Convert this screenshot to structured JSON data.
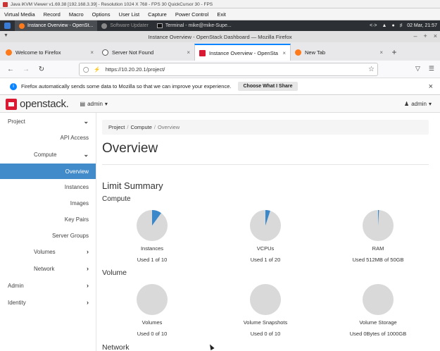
{
  "vnc": {
    "title": "Java iKVM Viewer v1.69.38 [192.168.3.39] - Resolution 1024 X 768 - FPS 30 QuickCursor 30 - FPS",
    "menu": [
      "Virtual Media",
      "Record",
      "Macro",
      "Options",
      "User List",
      "Capture",
      "Power Control",
      "Exit"
    ]
  },
  "taskbar": {
    "tasks": [
      {
        "label": "Instance Overview - OpenSt...",
        "active": true
      },
      {
        "label": "Software Updater",
        "active": false
      },
      {
        "label": "Terminal - mike@mike-Supe...",
        "active": false
      }
    ],
    "clock": "02 Mar, 21:57"
  },
  "browser": {
    "window_title": "Instance Overview - OpenStack Dashboard — Mozilla Firefox",
    "tabs": [
      {
        "label": "Welcome to Firefox",
        "icon": "firefox-icon",
        "active": false
      },
      {
        "label": "Server Not Found",
        "icon": "info-icon",
        "active": false
      },
      {
        "label": "Instance Overview - OpenSta",
        "icon": "openstack-icon",
        "active": true
      },
      {
        "label": "New Tab",
        "icon": "firefox-icon",
        "active": false
      }
    ],
    "url": "https://10.20.20.1/project/",
    "notification": "Firefox automatically sends some data to Mozilla so that we can improve your experience.",
    "notification_button": "Choose What I Share"
  },
  "header": {
    "logo_text": "openstack.",
    "project": "admin",
    "user": "admin"
  },
  "sidebar": [
    {
      "label": "Project",
      "level": 1,
      "chevron": "down"
    },
    {
      "label": "API Access",
      "level": 3
    },
    {
      "label": "Compute",
      "level": 2,
      "chevron": "down"
    },
    {
      "label": "Overview",
      "level": 3,
      "active": true
    },
    {
      "label": "Instances",
      "level": 3
    },
    {
      "label": "Images",
      "level": 3
    },
    {
      "label": "Key Pairs",
      "level": 3
    },
    {
      "label": "Server Groups",
      "level": 3
    },
    {
      "label": "Volumes",
      "level": 2,
      "chevron": "right"
    },
    {
      "label": "Network",
      "level": 2,
      "chevron": "right"
    },
    {
      "label": "Admin",
      "level": 1,
      "chevron": "right"
    },
    {
      "label": "Identity",
      "level": 1,
      "chevron": "right"
    }
  ],
  "breadcrumb": [
    "Project",
    "Compute",
    "Overview"
  ],
  "page_title": "Overview",
  "limit_summary": {
    "heading": "Limit Summary",
    "sections": [
      {
        "title": "Compute",
        "charts": [
          {
            "label": "Instances",
            "used_text": "Used 1 of 10",
            "fraction": 0.1
          },
          {
            "label": "VCPUs",
            "used_text": "Used 1 of 20",
            "fraction": 0.05
          },
          {
            "label": "RAM",
            "used_text": "Used 512MB of 50GB",
            "fraction": 0.01
          }
        ]
      },
      {
        "title": "Volume",
        "charts": [
          {
            "label": "Volumes",
            "used_text": "Used 0 of 10",
            "fraction": 0
          },
          {
            "label": "Volume Snapshots",
            "used_text": "Used 0 of 10",
            "fraction": 0
          },
          {
            "label": "Volume Storage",
            "used_text": "Used 0Bytes of 1000GB",
            "fraction": 0
          }
        ]
      },
      {
        "title": "Network",
        "charts": []
      }
    ]
  },
  "colors": {
    "accent": "#428bca",
    "pie_used": "#3a87c9",
    "pie_free": "#d9d9d9",
    "brand": "#da1a32"
  }
}
